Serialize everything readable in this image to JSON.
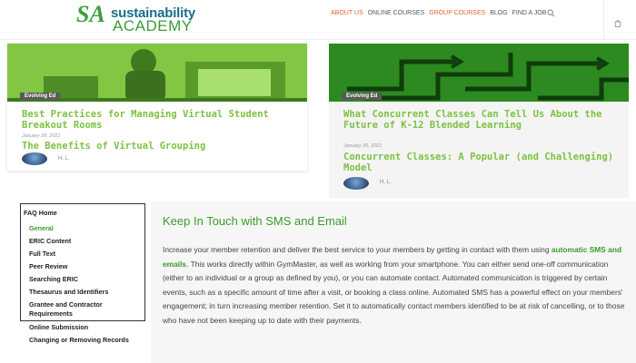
{
  "header": {
    "logo_mark": "SA",
    "logo_line1": "sustainability",
    "logo_line2": "ACADEMY",
    "nav": [
      "ABOUT US",
      "ONLINE COURSES",
      "GROUP COURSES",
      "BLOG",
      "FIND A JOB"
    ]
  },
  "cards": [
    {
      "badge": "Evolving Ed",
      "title": "Best Practices for Managing Virtual Student Breakout Rooms",
      "date": "January 28, 2021",
      "subtitle": "The Benefits of Virtual Grouping",
      "author": "H. L."
    },
    {
      "badge": "Evolving Ed",
      "title": "What Concurrent Classes Can Tell Us About the Future of K-12 Blended Learning",
      "date": "January 20, 2021",
      "subtitle": "Concurrent Classes: A Popular (and Challenging) Model",
      "author": "H. L."
    }
  ],
  "faq": {
    "heading": "FAQ Home",
    "items": [
      "General",
      "ERIC Content",
      "Full Text",
      "Peer Review",
      "Searching ERIC",
      "Thesaurus and Identifiers",
      "Grantee and Contractor Requirements",
      "Online Submission",
      "Changing or Removing Records"
    ]
  },
  "article": {
    "title": "Keep In Touch with SMS and Email",
    "body_before": "Increase your member retention and deliver the best service to your members by getting in contact with them using ",
    "body_link": "automatic SMS and emails",
    "body_after": ". This works directly within GymMaster, as well as working from your smartphone. You can either send one-off communication (either to an individual or a group as defined by you), or you can automate contact. Automated communication is triggered by certain events, such as a specific amount of time after a visit, or booking a class online. Automated SMS has a powerful effect on your members' engagement; in turn increasing member retention. Set it to automatically contact members identified to be at risk of cancelling, or to those who have not been keeping up to date with their payments."
  },
  "colors": {
    "accent_green": "#7cc242",
    "nav_orange": "#e0662a",
    "heading_green": "#3a9c2a"
  }
}
